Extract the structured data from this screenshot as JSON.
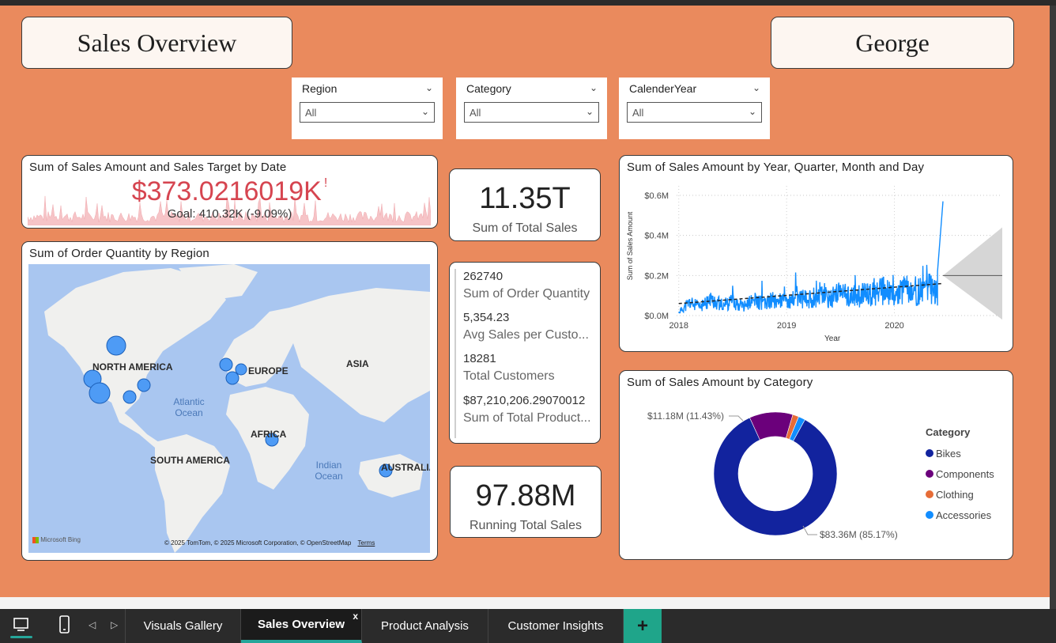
{
  "header": {
    "title": "Sales Overview",
    "user": "George"
  },
  "slicers": [
    {
      "label": "Region",
      "value": "All"
    },
    {
      "label": "Category",
      "value": "All"
    },
    {
      "label": "CalenderYear",
      "value": "All"
    }
  ],
  "sales_target": {
    "title": "Sum of Sales Amount and Sales Target by Date",
    "value": "$373.0216019K",
    "alert": "!",
    "goal": "Goal: 410.32K (-9.09%)",
    "value_color": "#d64550"
  },
  "total_sales": {
    "value": "11.35T",
    "label": "Sum of Total Sales"
  },
  "multi_card": [
    {
      "value": "262740",
      "label": "Sum of Order Quantity"
    },
    {
      "value": "5,354.23",
      "label": "Avg Sales per Custo..."
    },
    {
      "value": "18281",
      "label": "Total Customers"
    },
    {
      "value": "$87,210,206.29070012",
      "label": "Sum of Total Product..."
    }
  ],
  "running_total": {
    "value": "97.88M",
    "label": "Running Total Sales"
  },
  "map": {
    "title": "Sum of Order Quantity by Region",
    "labels": [
      "NORTH AMERICA",
      "EUROPE",
      "ASIA",
      "AFRICA",
      "SOUTH AMERICA",
      "AUSTRALIA"
    ],
    "oceans": [
      "Atlantic Ocean",
      "Indian Ocean"
    ],
    "bing": "Microsoft Bing",
    "attribution": "© 2025 TomTom, © 2025 Microsoft Corporation, © OpenStreetMap",
    "terms": "Terms"
  },
  "line_chart_text": {
    "title": "Sum of Sales Amount by Year, Quarter, Month and Day",
    "ylabel": "Sum of Sales Amount",
    "xlabel": "Year"
  },
  "donut_text": {
    "title": "Sum of Sales Amount by Category",
    "legend_title": "Category",
    "label_top": "$11.18M (11.43%)",
    "label_bottom": "$83.36M (85.17%)"
  },
  "chart_data": [
    {
      "type": "line",
      "title": "Sum of Sales Amount by Year, Quarter, Month and Day",
      "xlabel": "Year",
      "ylabel": "Sum of Sales Amount",
      "x_ticks": [
        "2018",
        "2019",
        "2020"
      ],
      "y_ticks": [
        "$0.0M",
        "$0.2M",
        "$0.4M",
        "$0.6M"
      ],
      "ylim": [
        0,
        0.6
      ],
      "xlim": [
        2018,
        2020.5
      ],
      "series": [
        {
          "name": "",
          "color": "#118dff",
          "x": [
            2018.0,
            2018.1,
            2018.2,
            2018.3,
            2018.4,
            2018.5,
            2018.6,
            2018.7,
            2018.8,
            2018.9,
            2019.0,
            2019.1,
            2019.2,
            2019.3,
            2019.4,
            2019.5,
            2019.6,
            2019.7,
            2019.8,
            2019.9,
            2020.0,
            2020.1,
            2020.2,
            2020.3,
            2020.4,
            2020.45
          ],
          "y": [
            0.03,
            0.12,
            0.08,
            0.15,
            0.1,
            0.13,
            0.09,
            0.14,
            0.11,
            0.16,
            0.12,
            0.18,
            0.14,
            0.2,
            0.15,
            0.22,
            0.17,
            0.19,
            0.2,
            0.23,
            0.18,
            0.24,
            0.21,
            0.26,
            0.22,
            0.57
          ]
        }
      ],
      "trend": {
        "start": 0.06,
        "end": 0.16
      },
      "forecast": {
        "value": 0.2,
        "upper": 0.44,
        "lower": -0.02,
        "x_end": 2021.0
      }
    },
    {
      "type": "pie",
      "title": "Sum of Sales Amount by Category",
      "legend_title": "Category",
      "legend_position": "right",
      "labels": [
        "Bikes",
        "Components",
        "Clothing",
        "Accessories"
      ],
      "values": [
        85.17,
        11.43,
        1.6,
        1.8
      ],
      "colors": [
        "#12239e",
        "#6b007b",
        "#e66c37",
        "#118dff"
      ],
      "donut": true
    }
  ],
  "tabs": {
    "visuals_gallery": "Visuals Gallery",
    "sales_overview": "Sales Overview",
    "product_analysis": "Product Analysis",
    "customer_insights": "Customer Insights",
    "close": "x",
    "add": "+"
  }
}
